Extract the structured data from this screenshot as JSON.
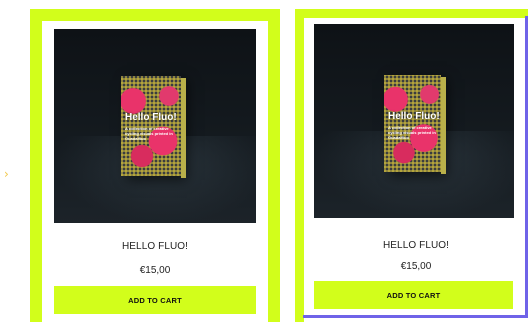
{
  "colors": {
    "accent": "#d2fe1b",
    "focus_outline": "#6f63e8",
    "text": "#222222"
  },
  "edge_icon": "chevron-right-icon",
  "products": [
    {
      "name": "HELLO FLUO!",
      "price": "€15,00",
      "cta_label": "ADD TO CART",
      "image": {
        "book_title": "Hello Fluo!",
        "book_subtitle": "A collection of creative cycling visuals printed in Guadalfluo"
      }
    },
    {
      "name": "HELLO FLUO!",
      "price": "€15,00",
      "cta_label": "ADD TO CART",
      "image": {
        "book_title": "Hello Fluo!",
        "book_subtitle": "A collection of creative cycling visuals printed in Guadalfluo"
      }
    }
  ]
}
